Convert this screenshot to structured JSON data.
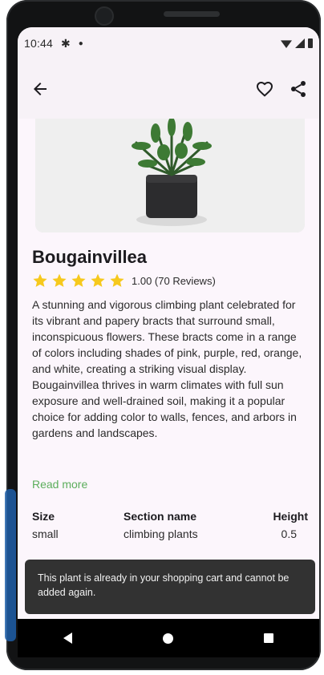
{
  "status_bar": {
    "time": "10:44",
    "left_icons": [
      "gear-icon",
      "dot-icon"
    ],
    "right_icons": [
      "wifi-icon",
      "signal-icon",
      "battery-icon"
    ]
  },
  "app_bar": {
    "back_icon": "arrow-left-icon",
    "favorite_icon": "heart-outline-icon",
    "share_icon": "share-icon"
  },
  "product": {
    "name": "Bougainvillea",
    "rating_value": "1.00 (70 Reviews)",
    "stars_filled": 5,
    "stars_total": 5,
    "star_color": "#f6c91d",
    "description": "A stunning and vigorous climbing plant celebrated for its vibrant and papery bracts that surround small, inconspicuous flowers. These bracts come in a range of colors including shades of pink, purple, red, orange, and white, creating a striking visual display. Bougainvillea thrives in warm climates with full sun exposure and well-drained soil, making it a popular choice for adding color to walls, fences, and arbors in gardens and landscapes.",
    "read_more": "Read more",
    "read_more_color": "#5cae5c"
  },
  "specs": {
    "size_label": "Size",
    "size_value": "small",
    "section_label": "Section name",
    "section_value": "climbing plants",
    "height_label": "Height",
    "height_value": "0.5"
  },
  "snackbar": {
    "message": "This plant is already in your shopping cart and cannot be added again."
  },
  "nav_bar": {
    "icons": [
      "nav-back-icon",
      "nav-home-icon",
      "nav-recent-icon"
    ]
  }
}
